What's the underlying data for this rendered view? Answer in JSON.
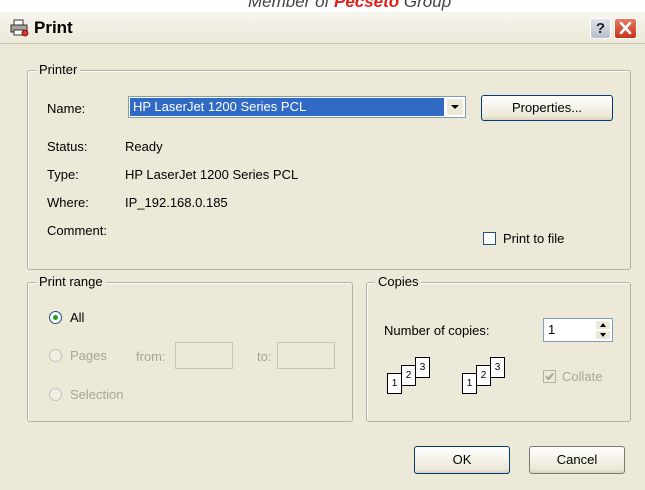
{
  "banner": {
    "prefix": "Member of ",
    "brand": "Pecseto",
    "suffix": " Group"
  },
  "window": {
    "title": "Print",
    "help_label": "?"
  },
  "printer": {
    "group_label": "Printer",
    "name_label": "Name:",
    "name_value": "HP LaserJet 1200 Series PCL",
    "properties_label": "Properties...",
    "status_label": "Status:",
    "status_value": "Ready",
    "type_label": "Type:",
    "type_value": "HP LaserJet 1200 Series PCL",
    "where_label": "Where:",
    "where_value": "IP_192.168.0.185",
    "comment_label": "Comment:",
    "comment_value": "",
    "print_to_file_label": "Print to file",
    "print_to_file_checked": false
  },
  "print_range": {
    "group_label": "Print range",
    "all_label": "All",
    "pages_label": "Pages",
    "from_label": "from:",
    "to_label": "to:",
    "from_value": "",
    "to_value": "",
    "selection_label": "Selection",
    "selected": "All"
  },
  "copies": {
    "group_label": "Copies",
    "number_label": "Number of copies:",
    "number_value": "1",
    "collate_label": "Collate",
    "collate_checked": true,
    "page_numbers": [
      "1",
      "2",
      "3"
    ]
  },
  "buttons": {
    "ok_label": "OK",
    "cancel_label": "Cancel"
  },
  "colors": {
    "selection": "#316ac5",
    "dialog_bg": "#ece9d8",
    "close_red": "#c5341b"
  },
  "icons": {
    "title": "printer-icon",
    "close": "close-icon",
    "dropdown": "chevron-down-icon"
  }
}
